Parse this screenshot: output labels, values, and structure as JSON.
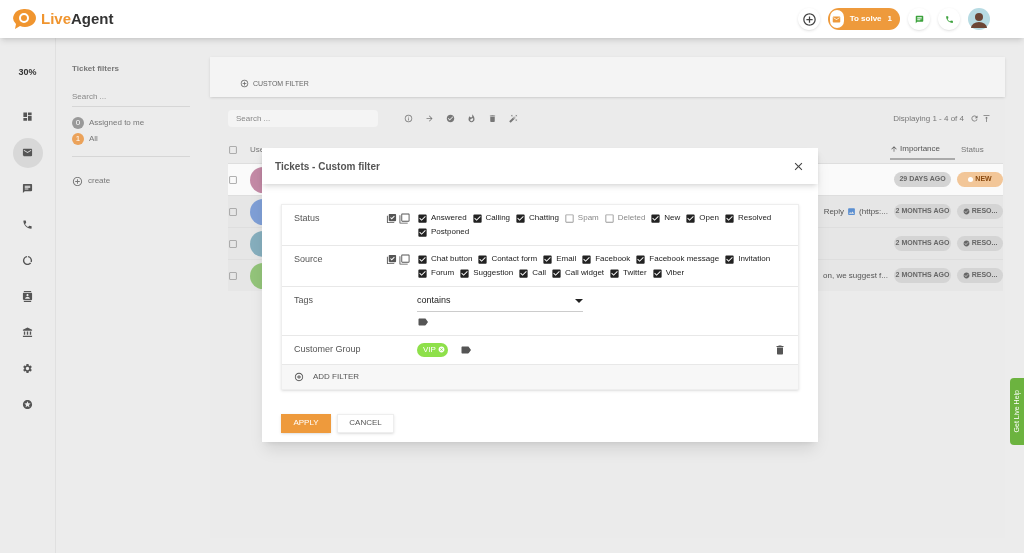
{
  "header": {
    "logo": {
      "accent": "Live",
      "rest": "Agent"
    },
    "to_solve": {
      "label": "To solve",
      "count": "1"
    }
  },
  "rail": {
    "percent": "30%",
    "items": [
      {
        "selected": false
      },
      {
        "selected": true
      },
      {
        "selected": false
      },
      {
        "selected": false
      },
      {
        "selected": false
      },
      {
        "selected": false
      },
      {
        "selected": false
      },
      {
        "selected": false
      },
      {
        "selected": false
      }
    ]
  },
  "filters_panel": {
    "title": "Ticket filters",
    "search": {
      "placeholder": "Search ..."
    },
    "items": [
      {
        "count": "0",
        "label": "Assigned to me",
        "selected": false
      },
      {
        "count": "1",
        "label": "All",
        "selected": true
      }
    ],
    "create": "create"
  },
  "custom_filter_button": "CUSTOM FILTER",
  "toolbar": {
    "search": {
      "placeholder": "Search ..."
    },
    "displaying": "Displaying 1 - 4 of 4"
  },
  "table": {
    "select_all": {
      "checked": false
    },
    "columns": [
      {
        "label": "Use",
        "sorted": false
      },
      {
        "label": "Importance",
        "sorted": true
      },
      {
        "label": "Status",
        "sorted": false
      }
    ],
    "rows": [
      {
        "selected": true,
        "checked": false,
        "excerpt": [],
        "importance": "29 DAYS AGO",
        "status": {
          "kind": "new",
          "label": "NEW"
        }
      },
      {
        "selected": false,
        "checked": false,
        "excerpt": [
          "Reply",
          "(https:..."
        ],
        "importance": "2 MONTHS AGO",
        "status": {
          "kind": "resolved",
          "label": "RESO..."
        }
      },
      {
        "selected": false,
        "checked": false,
        "excerpt": [],
        "importance": "2 MONTHS AGO",
        "status": {
          "kind": "resolved",
          "label": "RESO..."
        }
      },
      {
        "selected": false,
        "checked": false,
        "excerpt": [
          "on, we suggest f..."
        ],
        "importance": "2 MONTHS AGO",
        "status": {
          "kind": "resolved",
          "label": "RESO..."
        }
      }
    ]
  },
  "modal": {
    "title": "Tickets - Custom filter",
    "filters": [
      {
        "label": "Status",
        "kind": "checkboxes",
        "options": [
          {
            "label": "Answered",
            "checked": true
          },
          {
            "label": "Calling",
            "checked": true
          },
          {
            "label": "Chatting",
            "checked": true
          },
          {
            "label": "Spam",
            "checked": false
          },
          {
            "label": "Deleted",
            "checked": false
          },
          {
            "label": "New",
            "checked": true
          },
          {
            "label": "Open",
            "checked": true
          },
          {
            "label": "Resolved",
            "checked": true
          },
          {
            "label": "Postponed",
            "checked": true
          }
        ]
      },
      {
        "label": "Source",
        "kind": "checkboxes",
        "options": [
          {
            "label": "Chat button",
            "checked": true
          },
          {
            "label": "Contact form",
            "checked": true
          },
          {
            "label": "Email",
            "checked": true
          },
          {
            "label": "Facebook",
            "checked": true
          },
          {
            "label": "Facebook message",
            "checked": true
          },
          {
            "label": "Invitation",
            "checked": true
          },
          {
            "label": "Forum",
            "checked": true
          },
          {
            "label": "Suggestion",
            "checked": true
          },
          {
            "label": "Call",
            "checked": true
          },
          {
            "label": "Call widget",
            "checked": true
          },
          {
            "label": "Twitter",
            "checked": true
          },
          {
            "label": "Viber",
            "checked": true
          }
        ]
      },
      {
        "label": "Tags",
        "kind": "select",
        "value": "contains"
      },
      {
        "label": "Customer Group",
        "kind": "tags",
        "tags": [
          {
            "label": "VIP",
            "color": "#8ee04a"
          }
        ]
      }
    ],
    "add_filter": "ADD FILTER",
    "apply": "APPLY",
    "cancel": "CANCEL"
  },
  "live_help": "Get Live Help"
}
